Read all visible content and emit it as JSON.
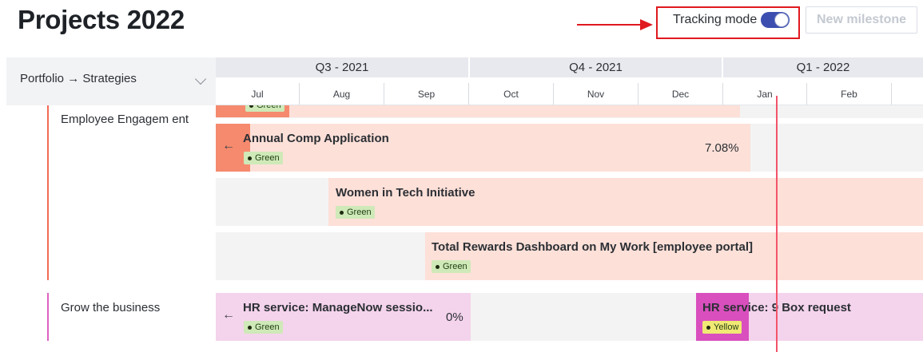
{
  "page": {
    "title": "Projects 2022"
  },
  "toolbar": {
    "tracking_label": "Tracking mode",
    "tracking_on": true,
    "new_milestone_label": "New milestone"
  },
  "filter": {
    "label": "Portfolio → Strategies"
  },
  "timeline": {
    "quarters": [
      "Q3 - 2021",
      "Q4 - 2021",
      "Q1 - 2022"
    ],
    "months": [
      "Jul",
      "Aug",
      "Sep",
      "Oct",
      "Nov",
      "Dec",
      "Jan",
      "Feb"
    ]
  },
  "groups": [
    {
      "name": "Employee Engagem ent",
      "color": "#f26a53"
    },
    {
      "name": "Grow the business",
      "color": "#e060c2"
    }
  ],
  "bars": {
    "partial": {
      "status": "Green"
    },
    "annual_comp": {
      "title": "Annual Comp Application",
      "status": "Green",
      "progress": "7.08%"
    },
    "women_tech": {
      "title": "Women in Tech Initiative",
      "status": "Green"
    },
    "total_rewards": {
      "title": "Total Rewards Dashboard on My Work [employee portal]",
      "status": "Green"
    },
    "hr_managenow": {
      "title": "HR service: ManageNow sessio...",
      "status": "Green",
      "progress": "0%"
    },
    "hr_9box": {
      "title": "HR service: 9 Box request",
      "status": "Yellow"
    }
  },
  "icons": {
    "back": "arrow-left-icon",
    "dropdown": "chevron-down-icon"
  },
  "colors": {
    "engagement_bar": "#fde0d8",
    "growth_bar": "#f4d3ec",
    "today_line": "#f2546a",
    "annotation": "#e0191f"
  }
}
